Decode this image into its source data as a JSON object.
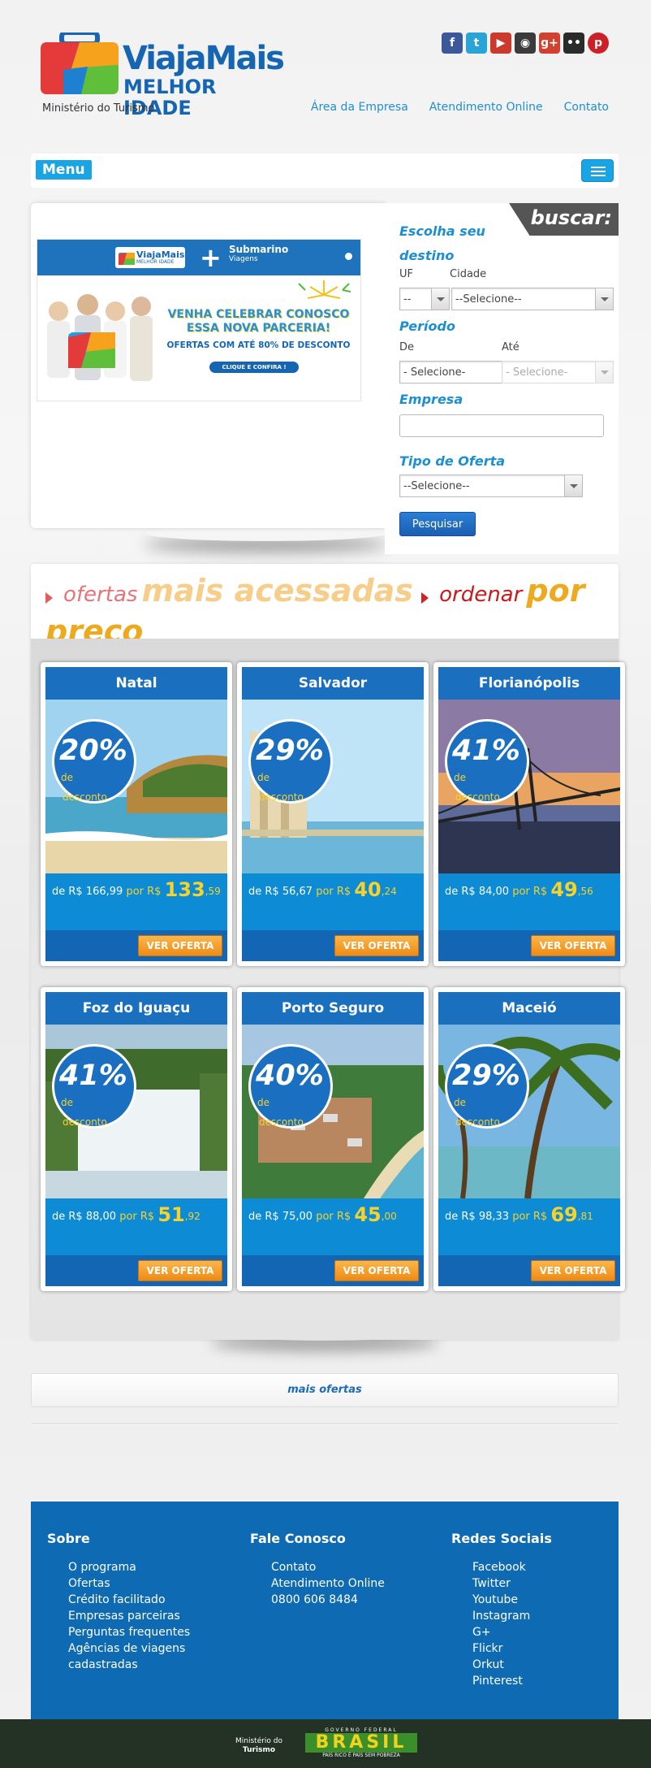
{
  "brand": {
    "title": "ViajaMais",
    "subtitle": "MELHOR IDADE",
    "ministry": "Ministério do Turismo"
  },
  "social_icons": [
    "facebook-icon",
    "twitter-icon",
    "youtube-icon",
    "instagram-icon",
    "googleplus-icon",
    "flickr-icon",
    "pinterest-icon"
  ],
  "topnav": {
    "empresa": "Área da Empresa",
    "atendimento": "Atendimento Online",
    "contato": "Contato"
  },
  "menu": {
    "label": "Menu"
  },
  "banner": {
    "logo_title": "ViajaMais",
    "logo_sub": "MELHOR IDADE",
    "partner": "Submarino",
    "partner_sub": "Viagens",
    "headline": "VENHA CELEBRAR CONOSCO ESSA NOVA PARCERIA!",
    "offer": "OFERTAS COM ATÉ 80% DE DESCONTO",
    "cta": "CLIQUE E CONFIRA !"
  },
  "search": {
    "tab": "buscar:",
    "destino_title": "Escolha seu destino",
    "uf_label": "UF",
    "uf_value": "--",
    "cidade_label": "Cidade",
    "cidade_value": "--Selecione--",
    "periodo_title": "Período",
    "de_label": "De",
    "de_value": "- Selecione-",
    "ate_label": "Até",
    "ate_value": "- Selecione-",
    "empresa_title": "Empresa",
    "empresa_value": "",
    "tipo_title": "Tipo de Oferta",
    "tipo_value": "--Selecione--",
    "button": "Pesquisar"
  },
  "offers_title": {
    "part1_light": "ofertas",
    "part1_bold": "mais acessadas",
    "part2_light": "ordenar",
    "part2_bold": "por preço"
  },
  "offers": [
    {
      "city": "Natal",
      "discount": "20%",
      "de": "de",
      "desc": "desconto",
      "from_label": "de R$ 166,99",
      "por": "por R$",
      "price": "133",
      "cents": ",59",
      "cta": "VER OFERTA",
      "theme": "beach"
    },
    {
      "city": "Salvador",
      "discount": "29%",
      "de": "de",
      "desc": "desconto",
      "from_label": "de R$ 56,67",
      "por": "por R$",
      "price": "40",
      "cents": ",24",
      "cta": "VER OFERTA",
      "theme": "elevator"
    },
    {
      "city": "Florianópolis",
      "discount": "41%",
      "de": "de",
      "desc": "desconto",
      "from_label": "de R$ 84,00",
      "por": "por R$",
      "price": "49",
      "cents": ",56",
      "cta": "VER OFERTA",
      "theme": "bridge"
    },
    {
      "city": "Foz do Iguaçu",
      "discount": "41%",
      "de": "de",
      "desc": "desconto",
      "from_label": "de R$ 88,00",
      "por": "por R$",
      "price": "51",
      "cents": ",92",
      "cta": "VER OFERTA",
      "theme": "falls"
    },
    {
      "city": "Porto Seguro",
      "discount": "40%",
      "de": "de",
      "desc": "desconto",
      "from_label": "de R$ 75,00",
      "por": "por R$",
      "price": "45",
      "cents": ",00",
      "cta": "VER OFERTA",
      "theme": "town"
    },
    {
      "city": "Maceió",
      "discount": "29%",
      "de": "de",
      "desc": "desconto",
      "from_label": "de R$ 98,33",
      "por": "por R$",
      "price": "69",
      "cents": ",81",
      "cta": "VER OFERTA",
      "theme": "palms"
    }
  ],
  "more": {
    "label": "mais ofertas"
  },
  "footer": {
    "sobre": {
      "title": "Sobre",
      "items": [
        "O programa",
        "Ofertas",
        "Crédito facilitado",
        "Empresas parceiras",
        "Perguntas frequentes",
        "Agências de viagens",
        "cadastradas"
      ]
    },
    "fale": {
      "title": "Fale Conosco",
      "items": [
        "Contato",
        "Atendimento Online",
        "0800 606 8484"
      ]
    },
    "redes": {
      "title": "Redes Sociais",
      "items": [
        "Facebook",
        "Twitter",
        "Youtube",
        "Instagram",
        "G+",
        "Flickr",
        "Orkut",
        "Pinterest"
      ]
    }
  },
  "bottom": {
    "ministry_line1": "Ministério do",
    "ministry_line2": "Turismo",
    "gov": "GOVERNO FEDERAL",
    "brasil": "BRASIL",
    "slogan": "PAÍS RICO É PAÍS SEM POBREZA"
  },
  "colors": {
    "brand_blue": "#1565b3",
    "card_blue": "#0d8bd5",
    "orange": "#ef8a16",
    "yellow": "#f6d22a"
  }
}
